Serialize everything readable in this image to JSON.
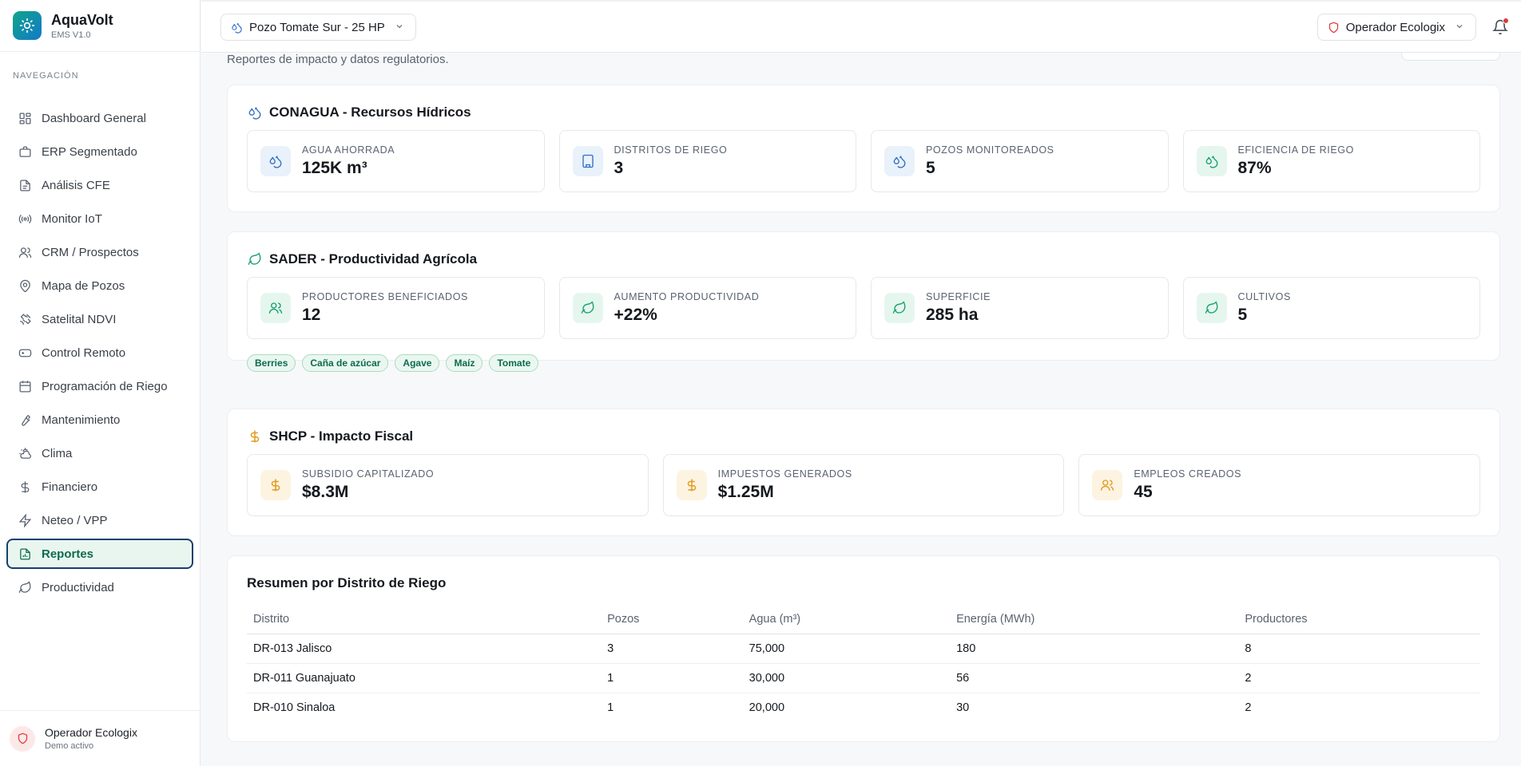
{
  "brand": {
    "name": "AquaVolt",
    "version": "EMS V1.0"
  },
  "sidebar": {
    "heading": "NAVEGACIÓN",
    "items": [
      {
        "label": "Dashboard General",
        "icon": "dashboard-icon"
      },
      {
        "label": "ERP Segmentado",
        "icon": "briefcase-icon"
      },
      {
        "label": "Análisis CFE",
        "icon": "document-icon"
      },
      {
        "label": "Monitor IoT",
        "icon": "radio-icon"
      },
      {
        "label": "CRM / Prospectos",
        "icon": "users-icon"
      },
      {
        "label": "Mapa de Pozos",
        "icon": "map-pin-icon"
      },
      {
        "label": "Satelital NDVI",
        "icon": "satellite-icon"
      },
      {
        "label": "Control Remoto",
        "icon": "gamepad-icon"
      },
      {
        "label": "Programación de Riego",
        "icon": "calendar-icon"
      },
      {
        "label": "Mantenimiento",
        "icon": "wrench-icon"
      },
      {
        "label": "Clima",
        "icon": "cloud-sun-icon"
      },
      {
        "label": "Financiero",
        "icon": "dollar-icon"
      },
      {
        "label": "Neteo / VPP",
        "icon": "bolt-icon"
      },
      {
        "label": "Reportes",
        "icon": "report-icon",
        "active": true
      },
      {
        "label": "Productividad",
        "icon": "leaf-icon"
      }
    ],
    "footer": {
      "name": "Operador Ecologix",
      "status": "Demo activo"
    }
  },
  "topbar": {
    "well_selector": "Pozo Tomate Sur - 25 HP",
    "operator_selector": "Operador Ecologix"
  },
  "main": {
    "subtitle": "Reportes de impacto y datos regulatorios.",
    "conagua": {
      "title": "CONAGUA - Recursos Hídricos",
      "stats": [
        {
          "label": "Agua Ahorrada",
          "value": "125K m³"
        },
        {
          "label": "Distritos de Riego",
          "value": "3"
        },
        {
          "label": "Pozos Monitoreados",
          "value": "5"
        },
        {
          "label": "Eficiencia de Riego",
          "value": "87%"
        }
      ]
    },
    "sader": {
      "title": "SADER - Productividad Agrícola",
      "stats": [
        {
          "label": "Productores Beneficiados",
          "value": "12"
        },
        {
          "label": "Aumento Productividad",
          "value": "+22%"
        },
        {
          "label": "Superficie",
          "value": "285 ha"
        },
        {
          "label": "Cultivos",
          "value": "5"
        }
      ],
      "crops": [
        "Berries",
        "Caña de azúcar",
        "Agave",
        "Maíz",
        "Tomate"
      ]
    },
    "shcp": {
      "title": "SHCP - Impacto Fiscal",
      "stats": [
        {
          "label": "Subsidio Capitalizado",
          "value": "$8.3M"
        },
        {
          "label": "Impuestos Generados",
          "value": "$1.25M"
        },
        {
          "label": "Empleos Creados",
          "value": "45"
        }
      ]
    },
    "summary": {
      "title": "Resumen por Distrito de Riego",
      "columns": [
        "Distrito",
        "Pozos",
        "Agua (m³)",
        "Energía (MWh)",
        "Productores"
      ],
      "rows": [
        [
          "DR-013 Jalisco",
          "3",
          "75,000",
          "180",
          "8"
        ],
        [
          "DR-011 Guanajuato",
          "1",
          "30,000",
          "56",
          "2"
        ],
        [
          "DR-010 Sinaloa",
          "1",
          "20,000",
          "30",
          "2"
        ]
      ]
    }
  },
  "colors": {
    "accent": "#0d6b4f",
    "blue": "#2f6fc4",
    "green": "#14a06a",
    "amber": "#e19a1e",
    "alert": "#e23a3a"
  }
}
